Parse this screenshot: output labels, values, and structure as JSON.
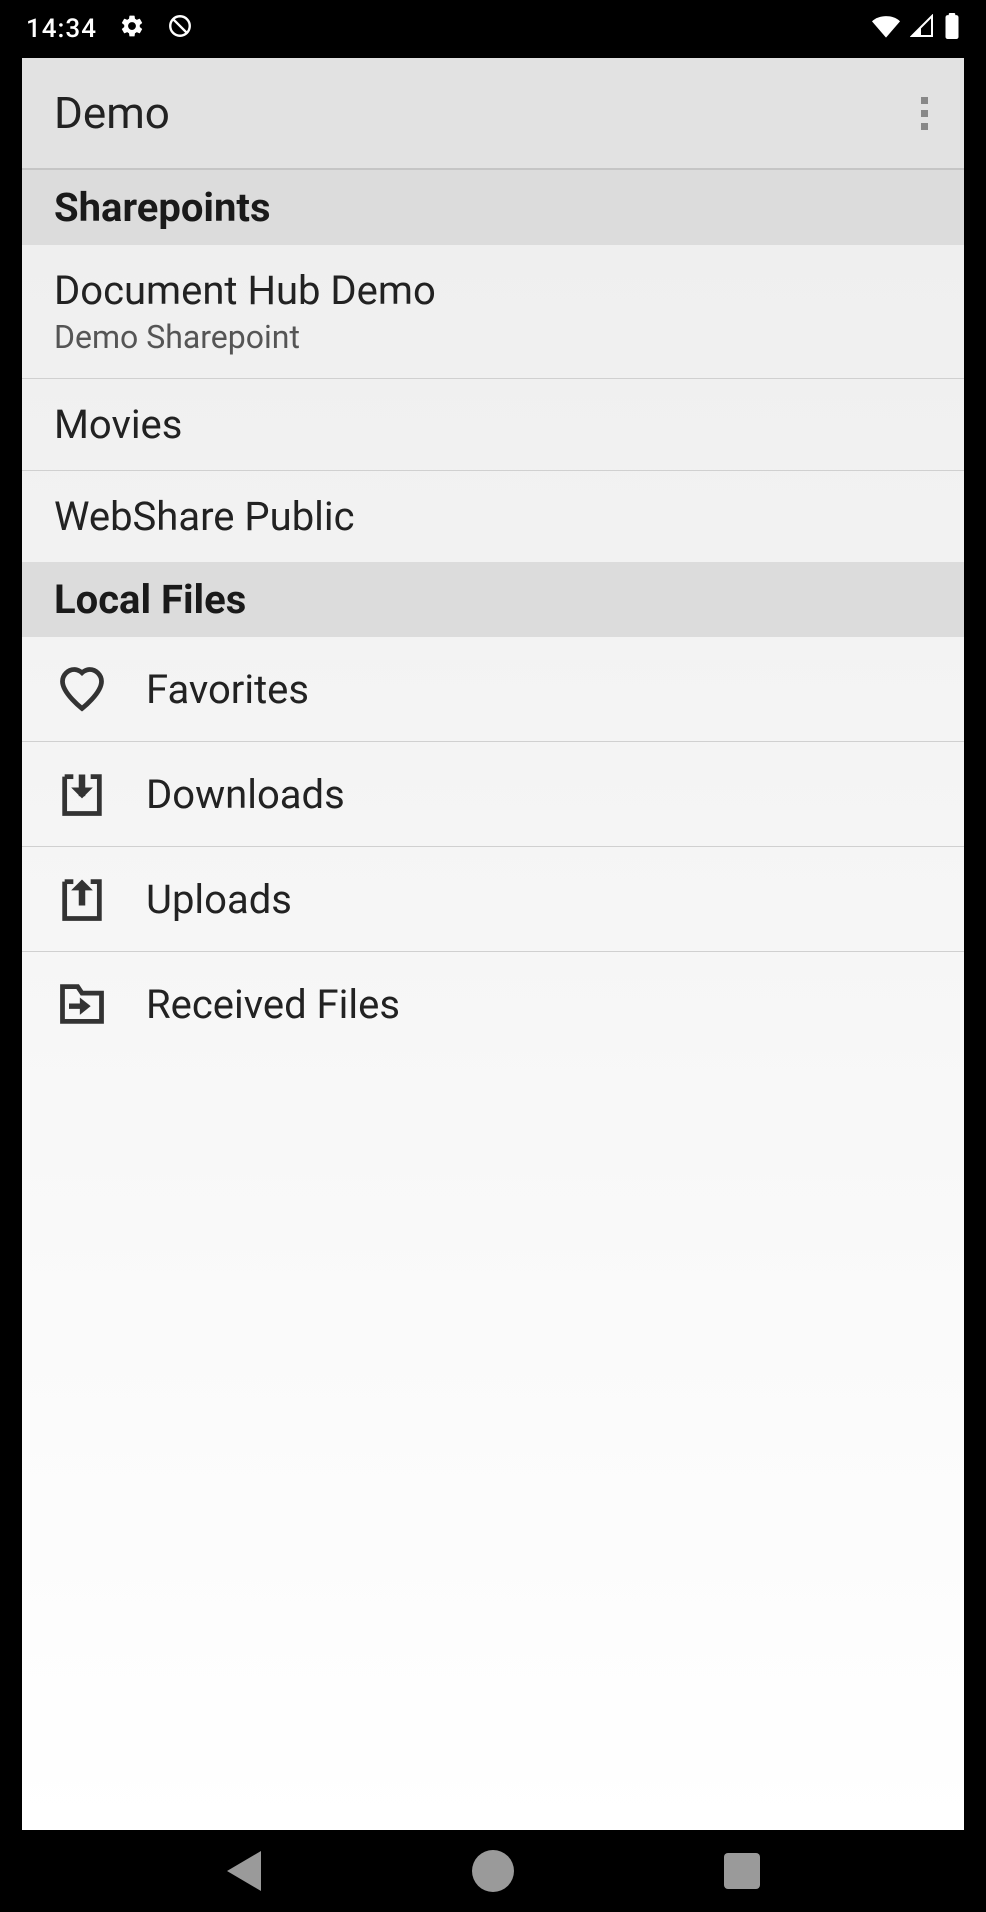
{
  "status_bar": {
    "time": "14:34"
  },
  "app_bar": {
    "title": "Demo"
  },
  "sections": {
    "sharepoints": {
      "header": "Sharepoints",
      "items": [
        {
          "title": "Document Hub Demo",
          "subtitle": "Demo Sharepoint"
        },
        {
          "title": "Movies"
        },
        {
          "title": "WebShare Public"
        }
      ]
    },
    "local_files": {
      "header": "Local Files",
      "items": [
        {
          "label": "Favorites",
          "icon": "heart"
        },
        {
          "label": "Downloads",
          "icon": "download"
        },
        {
          "label": "Uploads",
          "icon": "upload"
        },
        {
          "label": "Received Files",
          "icon": "received"
        }
      ]
    }
  }
}
